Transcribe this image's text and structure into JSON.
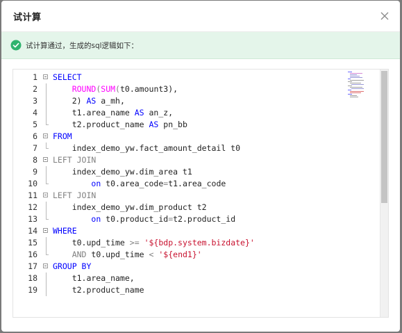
{
  "dialog": {
    "title": "试计算",
    "close_icon": "close-icon"
  },
  "banner": {
    "icon": "check-circle-icon",
    "status_color": "#2fb36e",
    "message": "试计算通过，生成的sql逻辑如下："
  },
  "editor": {
    "colors": {
      "keyword": "#0000ff",
      "keyword_muted": "#808080",
      "function": "#ff00ff",
      "string": "#c8102e"
    },
    "lines": [
      {
        "n": "1",
        "fold": true,
        "segments": [
          {
            "t": "SELECT",
            "c": "kw"
          }
        ]
      },
      {
        "n": "2",
        "fold": false,
        "segments": [
          {
            "t": "    "
          },
          {
            "t": "ROUND",
            "c": "fn"
          },
          {
            "t": "(",
            "c": "op"
          },
          {
            "t": "SUM",
            "c": "fn"
          },
          {
            "t": "(",
            "c": "op"
          },
          {
            "t": "t0.amount3),"
          }
        ]
      },
      {
        "n": "3",
        "fold": false,
        "segments": [
          {
            "t": "    2) "
          },
          {
            "t": "AS",
            "c": "kw"
          },
          {
            "t": " a_mh,"
          }
        ]
      },
      {
        "n": "4",
        "fold": false,
        "segments": [
          {
            "t": "    t1.area_name "
          },
          {
            "t": "AS",
            "c": "kw"
          },
          {
            "t": " an_z,"
          }
        ]
      },
      {
        "n": "5",
        "fold": false,
        "end": true,
        "segments": [
          {
            "t": "    t2.product_name "
          },
          {
            "t": "AS",
            "c": "kw"
          },
          {
            "t": " pn_bb"
          }
        ]
      },
      {
        "n": "6",
        "fold": true,
        "segments": [
          {
            "t": "FROM",
            "c": "kw"
          }
        ]
      },
      {
        "n": "7",
        "fold": false,
        "end": true,
        "segments": [
          {
            "t": "    index_demo_yw.fact_amount_detail t0"
          }
        ]
      },
      {
        "n": "8",
        "fold": true,
        "segments": [
          {
            "t": "LEFT JOIN",
            "c": "kw2"
          }
        ]
      },
      {
        "n": "9",
        "fold": false,
        "segments": [
          {
            "t": "    index_demo_yw.dim_area t1"
          }
        ]
      },
      {
        "n": "10",
        "fold": false,
        "end": true,
        "segments": [
          {
            "t": "        "
          },
          {
            "t": "on",
            "c": "kw"
          },
          {
            "t": " t0.area_code"
          },
          {
            "t": "=",
            "c": "op"
          },
          {
            "t": "t1.area_code"
          }
        ]
      },
      {
        "n": "11",
        "fold": true,
        "segments": [
          {
            "t": "LEFT JOIN",
            "c": "kw2"
          }
        ]
      },
      {
        "n": "12",
        "fold": false,
        "segments": [
          {
            "t": "    index_demo_yw.dim_product t2"
          }
        ]
      },
      {
        "n": "13",
        "fold": false,
        "end": true,
        "segments": [
          {
            "t": "        "
          },
          {
            "t": "on",
            "c": "kw"
          },
          {
            "t": " t0.product_id"
          },
          {
            "t": "=",
            "c": "op"
          },
          {
            "t": "t2.product_id"
          }
        ]
      },
      {
        "n": "14",
        "fold": true,
        "segments": [
          {
            "t": "WHERE",
            "c": "kw"
          }
        ]
      },
      {
        "n": "15",
        "fold": false,
        "segments": [
          {
            "t": "    t0.upd_time "
          },
          {
            "t": ">=",
            "c": "op"
          },
          {
            "t": " "
          },
          {
            "t": "'${bdp.system.bizdate}'",
            "c": "str"
          }
        ]
      },
      {
        "n": "16",
        "fold": false,
        "end": true,
        "segments": [
          {
            "t": "    "
          },
          {
            "t": "AND",
            "c": "kw2"
          },
          {
            "t": " t0.upd_time "
          },
          {
            "t": "<",
            "c": "op"
          },
          {
            "t": " "
          },
          {
            "t": "'${end1}'",
            "c": "str"
          }
        ]
      },
      {
        "n": "17",
        "fold": true,
        "segments": [
          {
            "t": "GROUP BY",
            "c": "kw"
          }
        ]
      },
      {
        "n": "18",
        "fold": false,
        "segments": [
          {
            "t": "    t1.area_name,"
          }
        ]
      },
      {
        "n": "19",
        "fold": false,
        "segments": [
          {
            "t": "    t2.product_name"
          }
        ]
      }
    ]
  }
}
